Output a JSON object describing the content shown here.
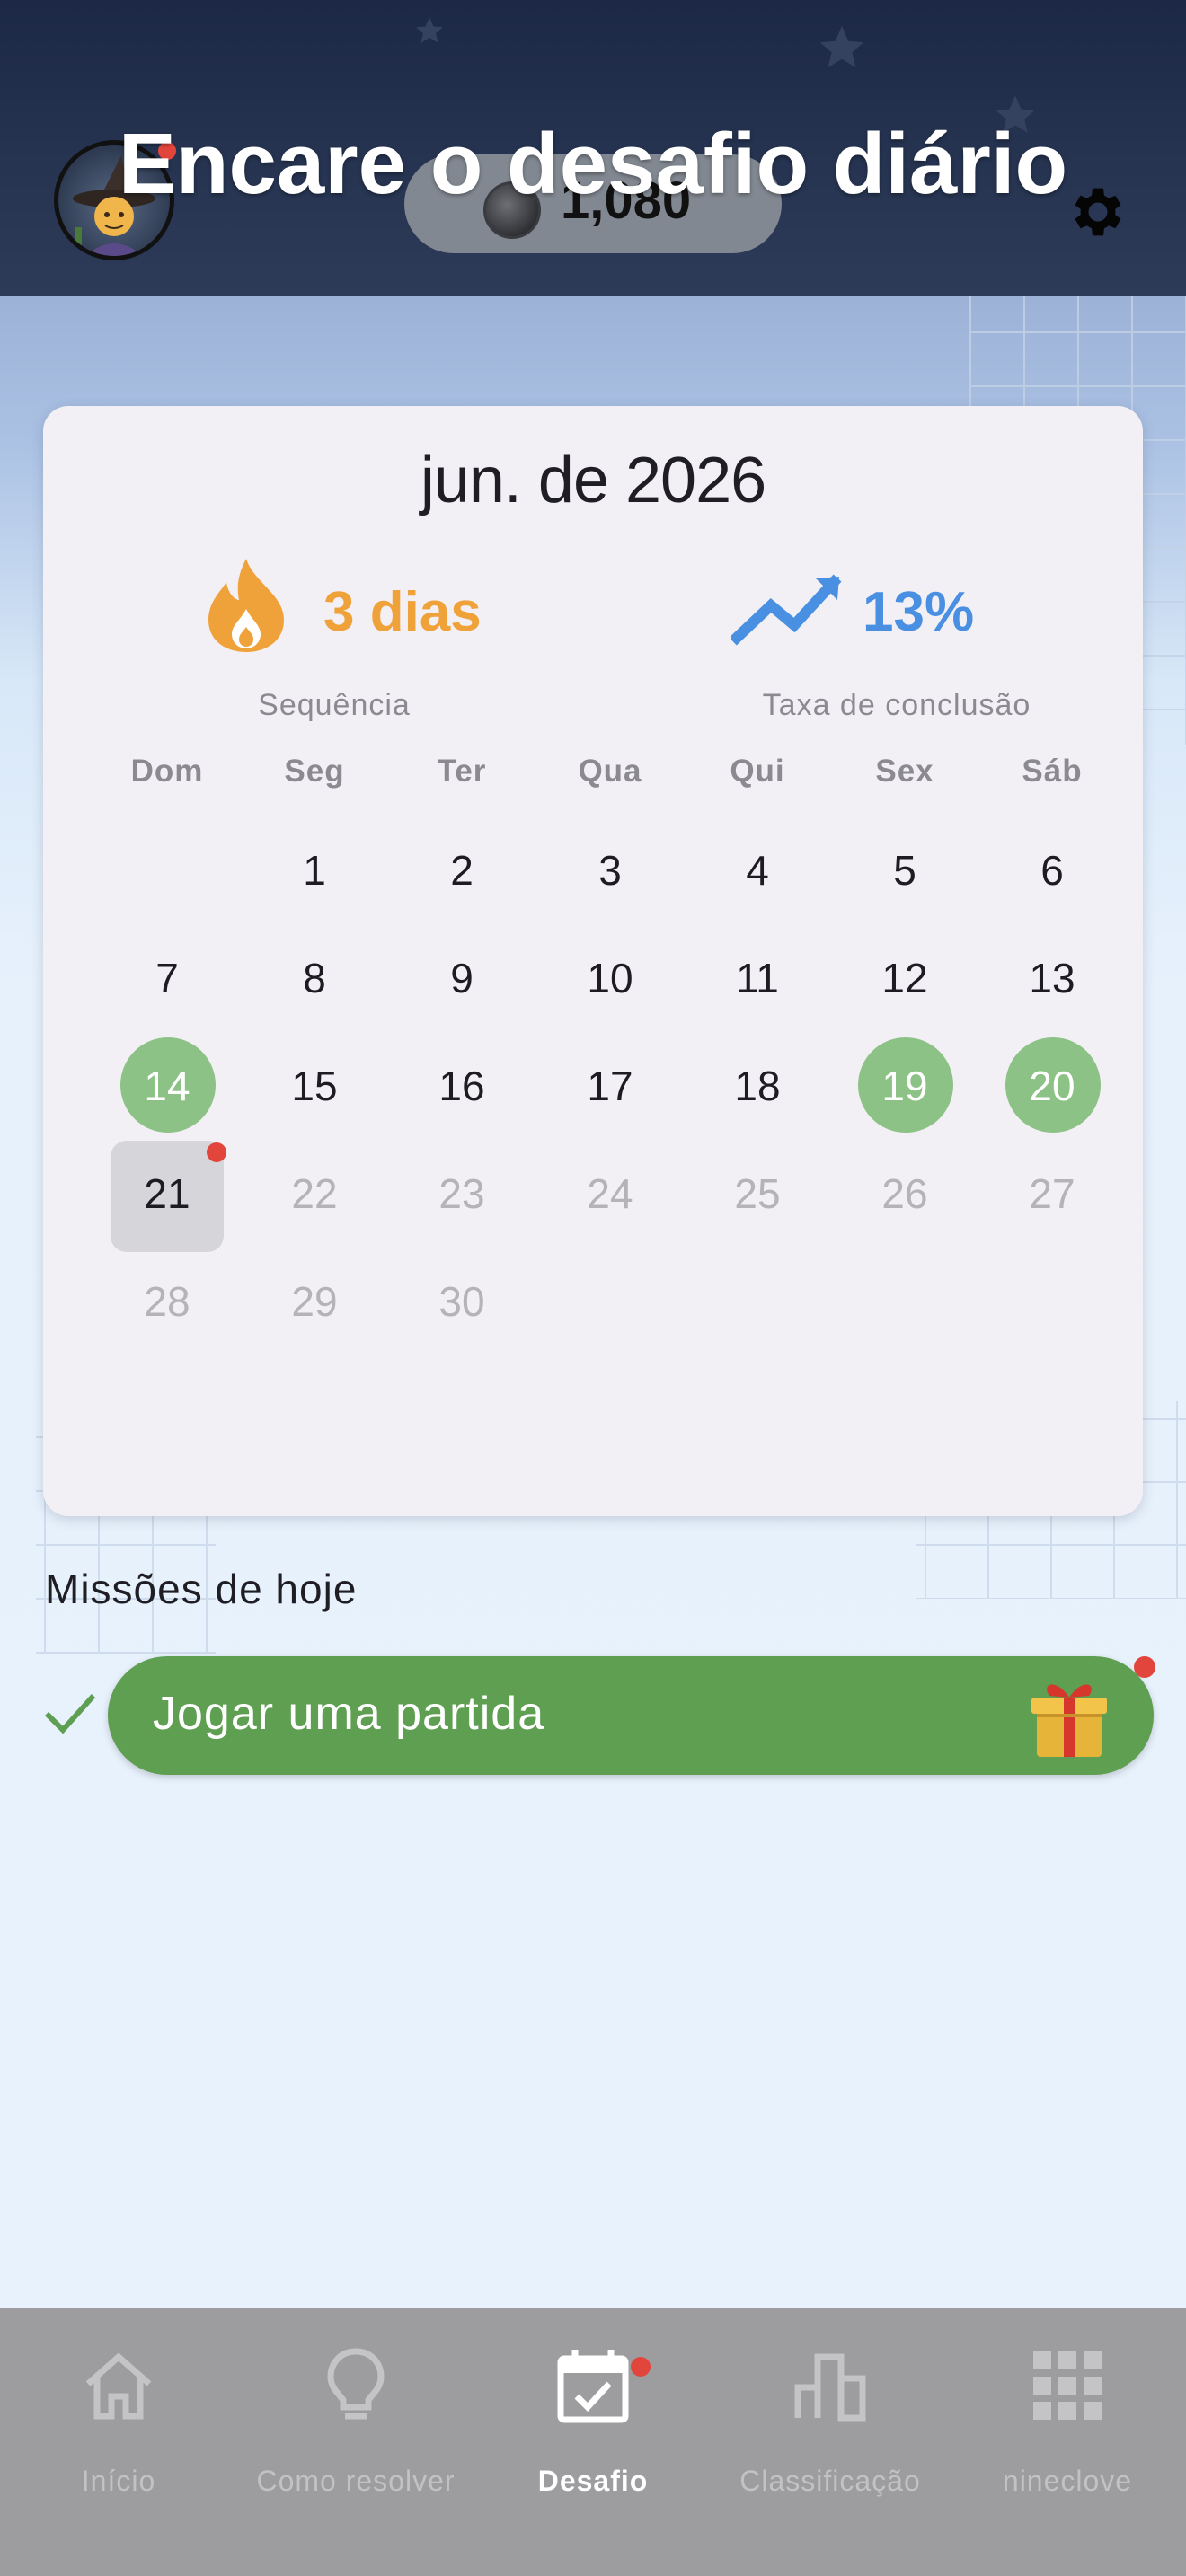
{
  "header": {
    "title": "Encare o desafio diário",
    "coins": "1,080"
  },
  "calendar": {
    "month_label": "jun. de 2026",
    "streak": {
      "value": "3 dias",
      "label": "Sequência",
      "icon": "flame-icon",
      "color": "#f0a23a"
    },
    "completion": {
      "value": "13%",
      "label": "Taxa de conclusão",
      "icon": "trend-up-icon",
      "color": "#4a90e2"
    },
    "weekdays": [
      "Dom",
      "Seg",
      "Ter",
      "Qua",
      "Qui",
      "Sex",
      "Sáb"
    ],
    "weeks": [
      [
        "",
        "1",
        "2",
        "3",
        "4",
        "5",
        "6"
      ],
      [
        "7",
        "8",
        "9",
        "10",
        "11",
        "12",
        "13"
      ],
      [
        "14",
        "15",
        "16",
        "17",
        "18",
        "19",
        "20"
      ],
      [
        "21",
        "22",
        "23",
        "24",
        "25",
        "26",
        "27"
      ],
      [
        "28",
        "29",
        "30",
        "",
        "",
        "",
        ""
      ]
    ],
    "completed_days": [
      "14",
      "19",
      "20"
    ],
    "today": "21",
    "completed_color": "#8dc286"
  },
  "missions": {
    "title": "Missões de hoje",
    "items": [
      {
        "label": "Jogar uma partida",
        "done": true,
        "reward_icon": "gift-icon"
      }
    ]
  },
  "nav": {
    "items": [
      {
        "label": "Início",
        "icon": "home-icon"
      },
      {
        "label": "Como resolver",
        "icon": "lightbulb-icon"
      },
      {
        "label": "Desafio",
        "icon": "calendar-check-icon",
        "active": true
      },
      {
        "label": "Classificação",
        "icon": "bar-chart-icon"
      },
      {
        "label": "nineclove",
        "icon": "grid-icon"
      }
    ]
  }
}
